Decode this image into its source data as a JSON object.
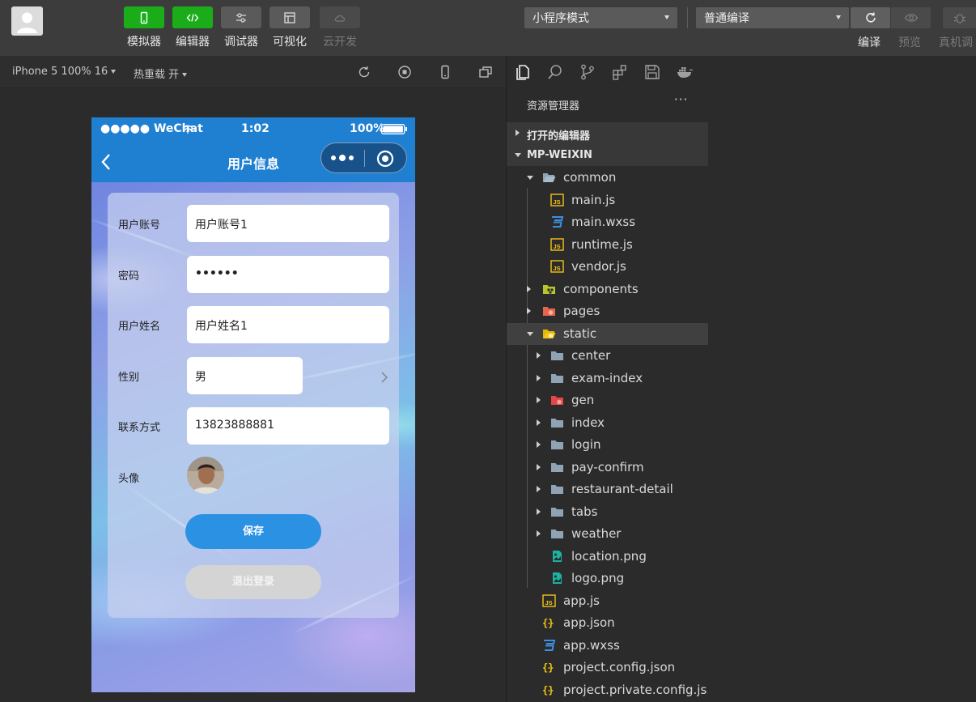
{
  "toolbar": {
    "tools": [
      {
        "label": "模拟器",
        "style": "green",
        "icon": "phone-icon"
      },
      {
        "label": "编辑器",
        "style": "green",
        "icon": "code-icon"
      },
      {
        "label": "调试器",
        "style": "gray",
        "icon": "debug-sliders-icon"
      },
      {
        "label": "可视化",
        "style": "gray",
        "icon": "layout-icon"
      },
      {
        "label": "云开发",
        "style": "dim",
        "icon": "cloud-icon"
      }
    ],
    "mode_select": "小程序模式",
    "compile_select": "普通编译",
    "actions": [
      {
        "label": "编译",
        "icon": "refresh-icon",
        "enabled": true
      },
      {
        "label": "预览",
        "icon": "eye-icon",
        "enabled": false
      },
      {
        "label": "真机调",
        "icon": "bug-icon",
        "enabled": false
      }
    ]
  },
  "simulator_bar": {
    "device": "iPhone 5 100% 16",
    "hot_reload": "热重载 开",
    "icons": [
      "rotate-icon",
      "stop-icon",
      "device-icon",
      "window-icon"
    ]
  },
  "phone": {
    "status": {
      "carrier": "●●●●● WeChat",
      "time": "1:02",
      "battery": "100%"
    },
    "nav_title": "用户信息",
    "form": {
      "account_label": "用户账号",
      "account_value": "用户账号1",
      "password_label": "密码",
      "password_value": "••••••",
      "name_label": "用户姓名",
      "name_value": "用户姓名1",
      "gender_label": "性别",
      "gender_value": "男",
      "phone_label": "联系方式",
      "phone_value": "13823888881",
      "avatar_label": "头像"
    },
    "save_label": "保存",
    "logout_label": "退出登录"
  },
  "explorer": {
    "title": "资源管理器",
    "more": "···",
    "open_editors": "打开的编辑器",
    "root": "MP-WEIXIN",
    "items": [
      {
        "name": "common",
        "depth": 1,
        "kind": "folder-open",
        "twisty": "down"
      },
      {
        "name": "main.js",
        "depth": 2,
        "kind": "js"
      },
      {
        "name": "main.wxss",
        "depth": 2,
        "kind": "css"
      },
      {
        "name": "runtime.js",
        "depth": 2,
        "kind": "js"
      },
      {
        "name": "vendor.js",
        "depth": 2,
        "kind": "js"
      },
      {
        "name": "components",
        "depth": 1,
        "kind": "folder-components",
        "twisty": "right"
      },
      {
        "name": "pages",
        "depth": 1,
        "kind": "folder-pages",
        "twisty": "right"
      },
      {
        "name": "static",
        "depth": 1,
        "kind": "folder-static",
        "twisty": "down",
        "selected": true
      },
      {
        "name": "center",
        "depth": 2,
        "kind": "folder",
        "twisty": "right"
      },
      {
        "name": "exam-index",
        "depth": 2,
        "kind": "folder",
        "twisty": "right"
      },
      {
        "name": "gen",
        "depth": 2,
        "kind": "folder-gen",
        "twisty": "right"
      },
      {
        "name": "index",
        "depth": 2,
        "kind": "folder",
        "twisty": "right"
      },
      {
        "name": "login",
        "depth": 2,
        "kind": "folder",
        "twisty": "right"
      },
      {
        "name": "pay-confirm",
        "depth": 2,
        "kind": "folder",
        "twisty": "right"
      },
      {
        "name": "restaurant-detail",
        "depth": 2,
        "kind": "folder",
        "twisty": "right"
      },
      {
        "name": "tabs",
        "depth": 2,
        "kind": "folder",
        "twisty": "right"
      },
      {
        "name": "weather",
        "depth": 2,
        "kind": "folder",
        "twisty": "right"
      },
      {
        "name": "location.png",
        "depth": 2,
        "kind": "image"
      },
      {
        "name": "logo.png",
        "depth": 2,
        "kind": "image"
      },
      {
        "name": "app.js",
        "depth": 1,
        "kind": "js"
      },
      {
        "name": "app.json",
        "depth": 1,
        "kind": "json"
      },
      {
        "name": "app.wxss",
        "depth": 1,
        "kind": "css"
      },
      {
        "name": "project.config.json",
        "depth": 1,
        "kind": "json"
      },
      {
        "name": "project.private.config.js...",
        "depth": 1,
        "kind": "json"
      }
    ]
  },
  "colors": {
    "accent_green": "#1aad19",
    "nav_blue": "#1f7fd1",
    "save_blue": "#2b91e3",
    "js_yellow": "#f5c518",
    "css_blue": "#3d8fe0",
    "folder_gray": "#8fa3b4"
  }
}
